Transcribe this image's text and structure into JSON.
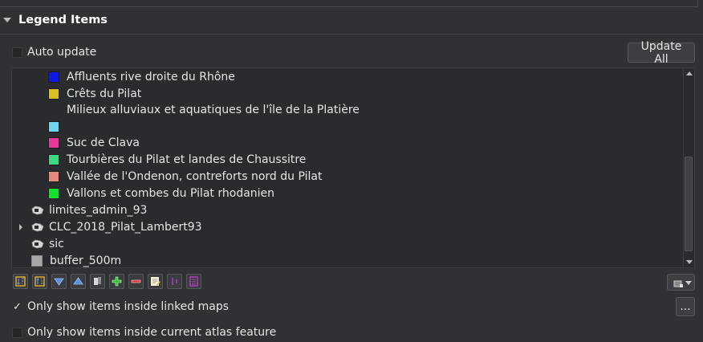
{
  "section": {
    "title": "Legend Items"
  },
  "auto_update": {
    "label": "Auto update",
    "checked": false
  },
  "update_all": {
    "label": "Update All"
  },
  "legend": {
    "class_items": [
      {
        "label": "Affluents rive droite du Rhône",
        "color": "#0a1adf"
      },
      {
        "label": "Crêts du Pilat",
        "color": "#d8c020"
      },
      {
        "label": "Milieux alluviaux et aquatiques de l'île de la Platière",
        "color": "#6fd4ee"
      },
      {
        "label": "Suc de Clava",
        "color": "#e8389c"
      },
      {
        "label": "Tourbières du Pilat et landes de Chaussitre",
        "color": "#3cd886"
      },
      {
        "label": "Vallée de l'Ondenon, contreforts nord du Pilat",
        "color": "#e48a7c"
      },
      {
        "label": "Vallons et combes du Pilat rhodanien",
        "color": "#10e030"
      }
    ],
    "layers": [
      {
        "label": "limites_admin_93",
        "icon": "polygon-layer-icon",
        "expandable": false
      },
      {
        "label": "CLC_2018_Pilat_Lambert93",
        "icon": "polygon-layer-icon",
        "expandable": true
      },
      {
        "label": "sic",
        "icon": "polygon-layer-icon",
        "expandable": false
      },
      {
        "label": "buffer_500m",
        "icon": "gray-square-icon",
        "expandable": false
      }
    ]
  },
  "toolbar": {
    "buttons": [
      {
        "name": "sort-descending-icon",
        "color": "#e0b030"
      },
      {
        "name": "sort-ascending-icon",
        "color": "#e0b030"
      },
      {
        "name": "move-down-icon",
        "color": "#5b8fd8"
      },
      {
        "name": "move-up-icon",
        "color": "#5b8fd8"
      },
      {
        "name": "add-group-icon",
        "color": "#d8d8d8"
      },
      {
        "name": "add-item-icon",
        "color": "#38c038"
      },
      {
        "name": "remove-item-icon",
        "color": "#d83838"
      },
      {
        "name": "edit-item-icon",
        "color": "#e8c050"
      },
      {
        "name": "filter-expression-icon",
        "color": "#b040c0"
      },
      {
        "name": "count-features-icon",
        "color": "#b040c0"
      }
    ]
  },
  "linked_maps": {
    "label": "Only show items inside linked maps",
    "checked": true,
    "check_glyph": "✓"
  },
  "more_button": {
    "label": "..."
  },
  "atlas_feature": {
    "label": "Only show items inside current atlas feature",
    "checked": false
  }
}
